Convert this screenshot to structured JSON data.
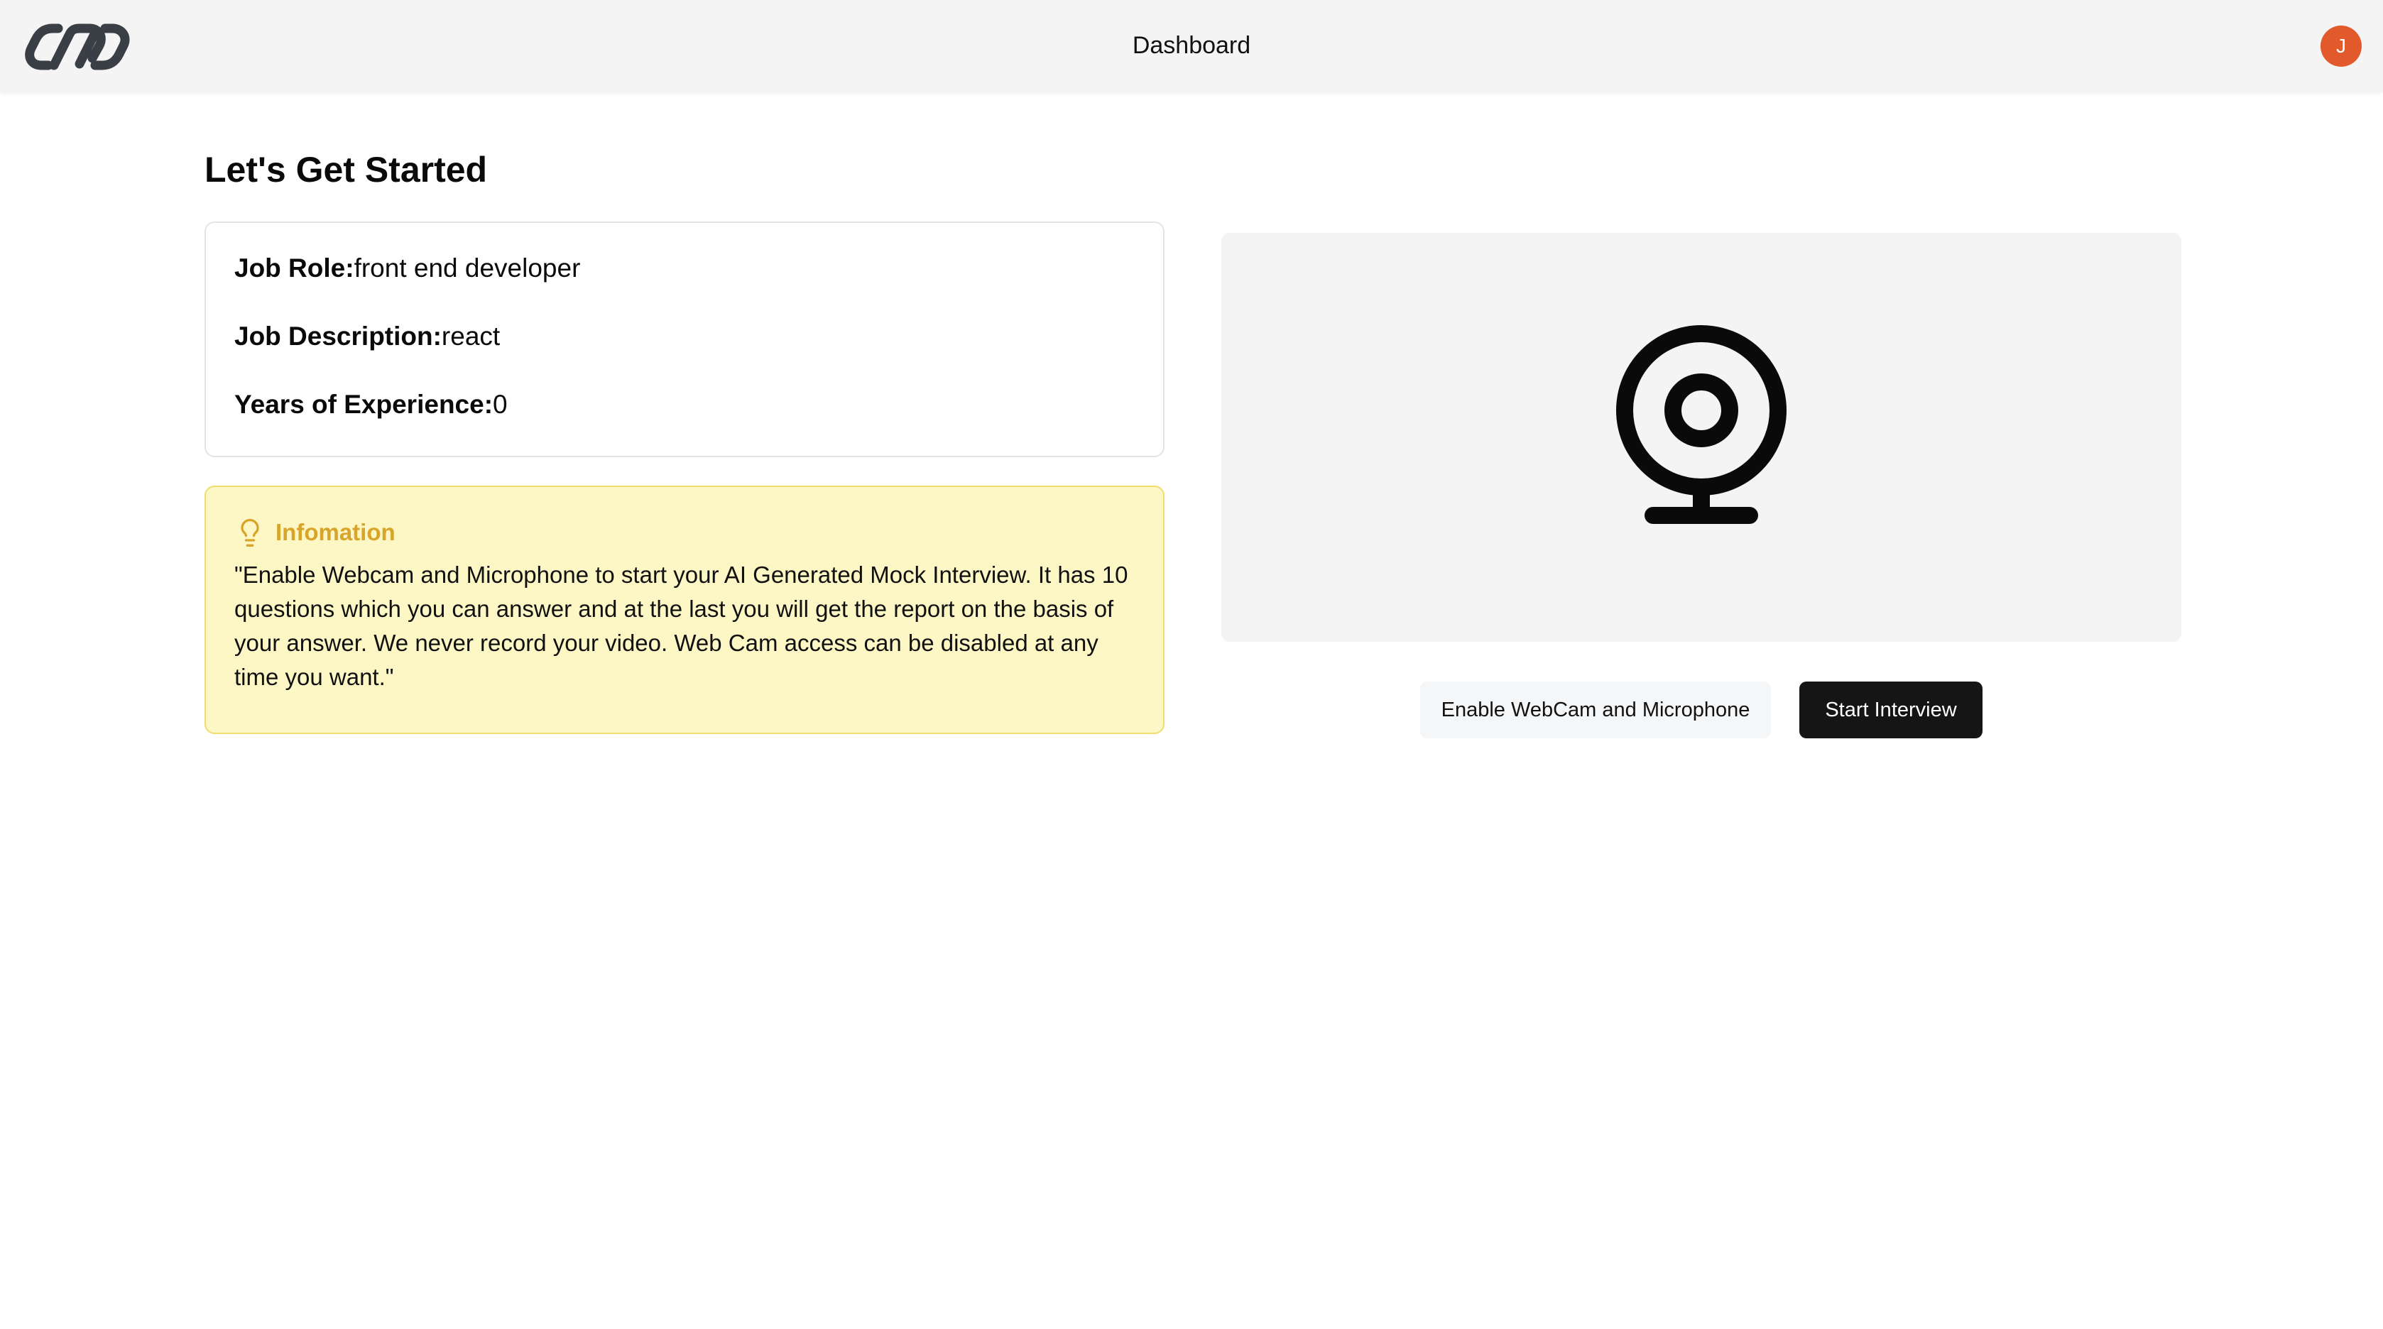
{
  "header": {
    "title": "Dashboard",
    "avatar_initial": "J",
    "avatar_color": "#e25a2c",
    "logo_icon": "chain-link-logo"
  },
  "main": {
    "title": "Let's Get Started",
    "details": [
      {
        "label": "Job Role:",
        "value": "front end developer"
      },
      {
        "label": "Job Description:",
        "value": "react"
      },
      {
        "label": "Years of Experience:",
        "value": "0"
      }
    ],
    "info": {
      "icon": "lightbulb-icon",
      "title": "Infomation",
      "text": "\"Enable Webcam and Microphone to start your AI Generated Mock Interview. It has 10 questions which you can answer and at the last you will get the report on the basis of your answer. We never record your video. Web Cam access can be disabled at any time you want.\"",
      "accent_color": "#d9a42a",
      "background_color": "#fcf7c5"
    },
    "webcam": {
      "icon": "webcam-icon"
    },
    "buttons": {
      "enable": "Enable WebCam and Microphone",
      "start": "Start Interview"
    }
  }
}
